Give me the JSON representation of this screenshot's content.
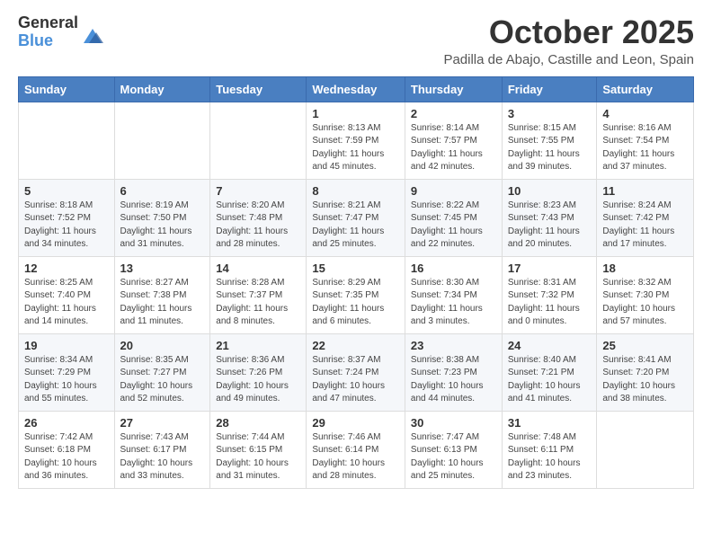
{
  "logo": {
    "general": "General",
    "blue": "Blue"
  },
  "header": {
    "month_title": "October 2025",
    "location": "Padilla de Abajo, Castille and Leon, Spain"
  },
  "weekdays": [
    "Sunday",
    "Monday",
    "Tuesday",
    "Wednesday",
    "Thursday",
    "Friday",
    "Saturday"
  ],
  "weeks": [
    [
      {
        "day": "",
        "info": ""
      },
      {
        "day": "",
        "info": ""
      },
      {
        "day": "",
        "info": ""
      },
      {
        "day": "1",
        "info": "Sunrise: 8:13 AM\nSunset: 7:59 PM\nDaylight: 11 hours and 45 minutes."
      },
      {
        "day": "2",
        "info": "Sunrise: 8:14 AM\nSunset: 7:57 PM\nDaylight: 11 hours and 42 minutes."
      },
      {
        "day": "3",
        "info": "Sunrise: 8:15 AM\nSunset: 7:55 PM\nDaylight: 11 hours and 39 minutes."
      },
      {
        "day": "4",
        "info": "Sunrise: 8:16 AM\nSunset: 7:54 PM\nDaylight: 11 hours and 37 minutes."
      }
    ],
    [
      {
        "day": "5",
        "info": "Sunrise: 8:18 AM\nSunset: 7:52 PM\nDaylight: 11 hours and 34 minutes."
      },
      {
        "day": "6",
        "info": "Sunrise: 8:19 AM\nSunset: 7:50 PM\nDaylight: 11 hours and 31 minutes."
      },
      {
        "day": "7",
        "info": "Sunrise: 8:20 AM\nSunset: 7:48 PM\nDaylight: 11 hours and 28 minutes."
      },
      {
        "day": "8",
        "info": "Sunrise: 8:21 AM\nSunset: 7:47 PM\nDaylight: 11 hours and 25 minutes."
      },
      {
        "day": "9",
        "info": "Sunrise: 8:22 AM\nSunset: 7:45 PM\nDaylight: 11 hours and 22 minutes."
      },
      {
        "day": "10",
        "info": "Sunrise: 8:23 AM\nSunset: 7:43 PM\nDaylight: 11 hours and 20 minutes."
      },
      {
        "day": "11",
        "info": "Sunrise: 8:24 AM\nSunset: 7:42 PM\nDaylight: 11 hours and 17 minutes."
      }
    ],
    [
      {
        "day": "12",
        "info": "Sunrise: 8:25 AM\nSunset: 7:40 PM\nDaylight: 11 hours and 14 minutes."
      },
      {
        "day": "13",
        "info": "Sunrise: 8:27 AM\nSunset: 7:38 PM\nDaylight: 11 hours and 11 minutes."
      },
      {
        "day": "14",
        "info": "Sunrise: 8:28 AM\nSunset: 7:37 PM\nDaylight: 11 hours and 8 minutes."
      },
      {
        "day": "15",
        "info": "Sunrise: 8:29 AM\nSunset: 7:35 PM\nDaylight: 11 hours and 6 minutes."
      },
      {
        "day": "16",
        "info": "Sunrise: 8:30 AM\nSunset: 7:34 PM\nDaylight: 11 hours and 3 minutes."
      },
      {
        "day": "17",
        "info": "Sunrise: 8:31 AM\nSunset: 7:32 PM\nDaylight: 11 hours and 0 minutes."
      },
      {
        "day": "18",
        "info": "Sunrise: 8:32 AM\nSunset: 7:30 PM\nDaylight: 10 hours and 57 minutes."
      }
    ],
    [
      {
        "day": "19",
        "info": "Sunrise: 8:34 AM\nSunset: 7:29 PM\nDaylight: 10 hours and 55 minutes."
      },
      {
        "day": "20",
        "info": "Sunrise: 8:35 AM\nSunset: 7:27 PM\nDaylight: 10 hours and 52 minutes."
      },
      {
        "day": "21",
        "info": "Sunrise: 8:36 AM\nSunset: 7:26 PM\nDaylight: 10 hours and 49 minutes."
      },
      {
        "day": "22",
        "info": "Sunrise: 8:37 AM\nSunset: 7:24 PM\nDaylight: 10 hours and 47 minutes."
      },
      {
        "day": "23",
        "info": "Sunrise: 8:38 AM\nSunset: 7:23 PM\nDaylight: 10 hours and 44 minutes."
      },
      {
        "day": "24",
        "info": "Sunrise: 8:40 AM\nSunset: 7:21 PM\nDaylight: 10 hours and 41 minutes."
      },
      {
        "day": "25",
        "info": "Sunrise: 8:41 AM\nSunset: 7:20 PM\nDaylight: 10 hours and 38 minutes."
      }
    ],
    [
      {
        "day": "26",
        "info": "Sunrise: 7:42 AM\nSunset: 6:18 PM\nDaylight: 10 hours and 36 minutes."
      },
      {
        "day": "27",
        "info": "Sunrise: 7:43 AM\nSunset: 6:17 PM\nDaylight: 10 hours and 33 minutes."
      },
      {
        "day": "28",
        "info": "Sunrise: 7:44 AM\nSunset: 6:15 PM\nDaylight: 10 hours and 31 minutes."
      },
      {
        "day": "29",
        "info": "Sunrise: 7:46 AM\nSunset: 6:14 PM\nDaylight: 10 hours and 28 minutes."
      },
      {
        "day": "30",
        "info": "Sunrise: 7:47 AM\nSunset: 6:13 PM\nDaylight: 10 hours and 25 minutes."
      },
      {
        "day": "31",
        "info": "Sunrise: 7:48 AM\nSunset: 6:11 PM\nDaylight: 10 hours and 23 minutes."
      },
      {
        "day": "",
        "info": ""
      }
    ]
  ]
}
